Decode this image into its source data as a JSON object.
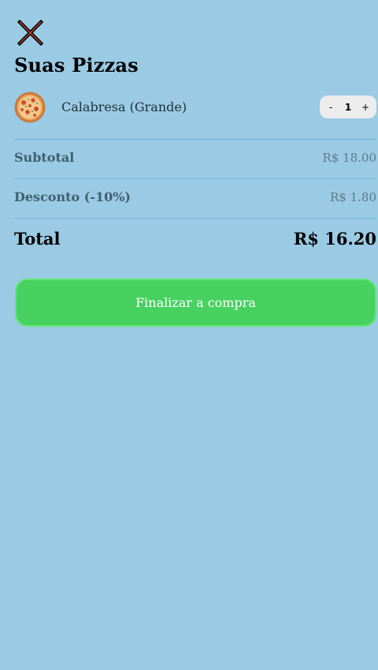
{
  "header": {
    "close_icon": "close-x-icon",
    "title": "Suas Pizzas"
  },
  "cart": {
    "items": [
      {
        "name": "Calabresa (Grande)",
        "image_icon": "pizza-icon",
        "decrement_label": "-",
        "quantity": "1",
        "increment_label": "+"
      }
    ]
  },
  "summary": {
    "subtotal_label": "Subtotal",
    "subtotal_value": "R$ 18.00",
    "discount_label": "Desconto (-10%)",
    "discount_value": "R$ 1.80",
    "total_label": "Total",
    "total_value": "R$ 16.20"
  },
  "checkout": {
    "button_label": "Finalizar a compra"
  },
  "colors": {
    "background": "#9ACAE4",
    "divider": "#70B5D2",
    "checkout_button": "#47D160",
    "close_icon_fill": "#E8502F"
  }
}
